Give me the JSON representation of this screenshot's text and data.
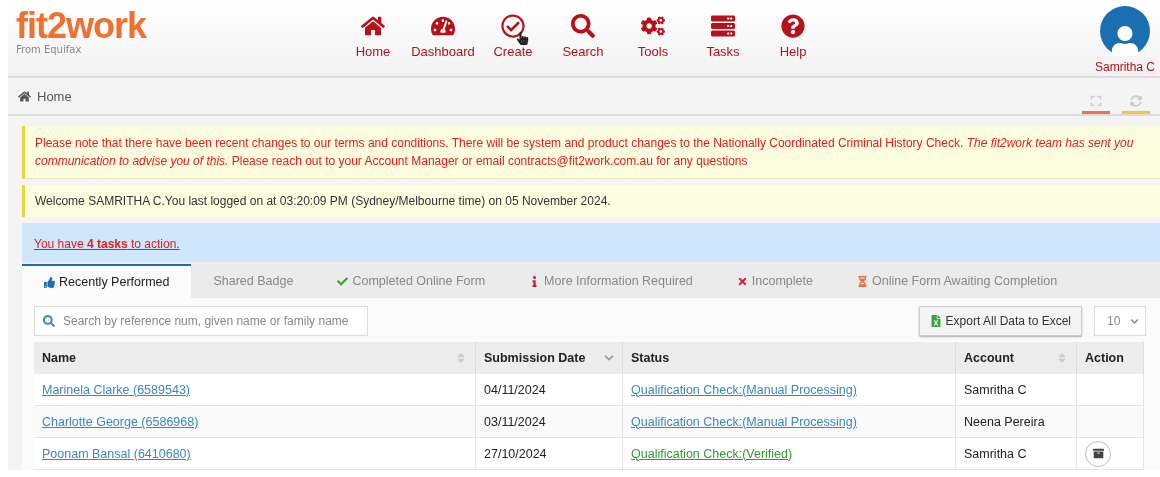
{
  "logo": {
    "brand": "fit2work",
    "tagline": "From Equifax"
  },
  "nav": [
    {
      "label": "Home",
      "hovered": false
    },
    {
      "label": "Dashboard",
      "hovered": false
    },
    {
      "label": "Create",
      "hovered": true
    },
    {
      "label": "Search",
      "hovered": false
    },
    {
      "label": "Tools",
      "hovered": false
    },
    {
      "label": "Tasks",
      "hovered": false
    },
    {
      "label": "Help",
      "hovered": false
    }
  ],
  "user": {
    "name": "Samritha C"
  },
  "breadcrumb": "Home",
  "notice": "Please note that there have been recent changes to our terms and conditions. There will be system and product changes to the Nationally Coordinated Criminal History Check. *The fit2work team has sent you communication to advise you of this.* Please reach out to your Account Manager or email contracts@fit2work.com.au for any questions",
  "welcome": "Welcome SAMRITHA C.You last logged on at 03:20:09 PM (Sydney/Melbourne time) on 05 November 2024.",
  "tasks_link": "You have **4 tasks** to action.",
  "tabs": [
    {
      "label": "Recently Performed",
      "selected": true
    },
    {
      "label": "Shared Badge",
      "selected": false
    },
    {
      "label": "Completed Online Form",
      "selected": false
    },
    {
      "label": "More Information Required",
      "selected": false
    },
    {
      "label": "Incomplete",
      "selected": false
    },
    {
      "label": "Online Form Awaiting Completion",
      "selected": false
    }
  ],
  "search": {
    "placeholder": "Search by reference num, given name or family name"
  },
  "export_button": "Export All Data to Excel",
  "page_size": "10",
  "table": {
    "columns": [
      {
        "label": "Name",
        "sortable": true,
        "sorted": false
      },
      {
        "label": "Submission Date",
        "sortable": true,
        "sorted": true
      },
      {
        "label": "Status",
        "sortable": false,
        "sorted": false
      },
      {
        "label": "Account",
        "sortable": true,
        "sorted": false
      },
      {
        "label": "Action",
        "sortable": false,
        "sorted": false
      }
    ],
    "rows": [
      {
        "name": "Marinela Clarke (6589543)",
        "date": "04/11/2024",
        "status": "Qualification Check:(Manual Processing)",
        "verified": false,
        "account": "Samritha C",
        "has_action": false
      },
      {
        "name": "Charlotte George (6586968)",
        "date": "03/11/2024",
        "status": "Qualification Check:(Manual Processing)",
        "verified": false,
        "account": "Neena Pereira",
        "has_action": false
      },
      {
        "name": "Poonam Bansal (6410680)",
        "date": "27/10/2024",
        "status": "Qualification Check:(Verified)",
        "verified": true,
        "account": "Samritha C",
        "has_action": true
      }
    ]
  }
}
